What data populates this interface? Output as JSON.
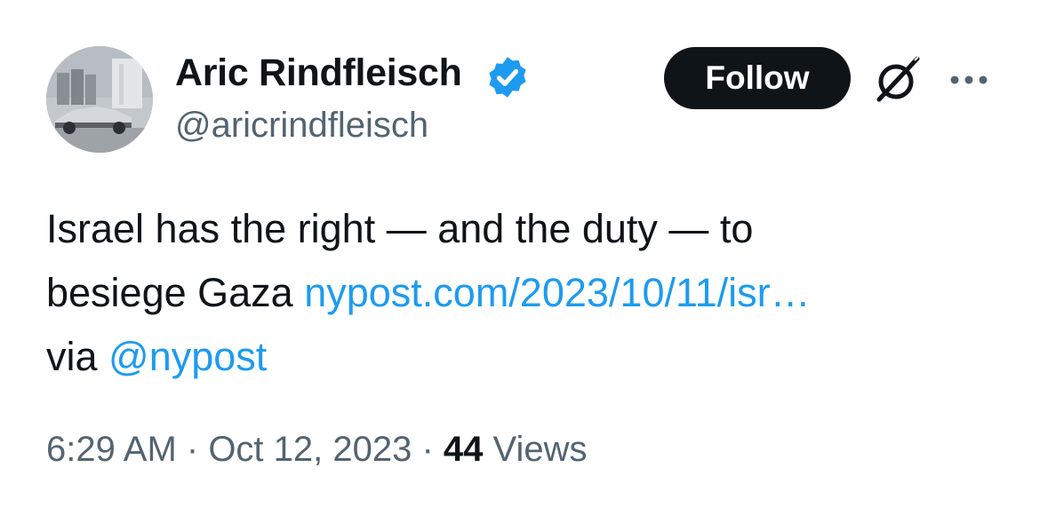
{
  "author": {
    "display_name": "Aric Rindfleisch",
    "handle": "@aricrindfleisch",
    "verified": true
  },
  "actions": {
    "follow_label": "Follow",
    "grok_icon": "grok-icon",
    "more_icon": "more-icon"
  },
  "tweet": {
    "line1": "Israel has the right — and the duty — to",
    "line2_text": "besiege Gaza ",
    "line2_link": "nypost.com/2023/10/11/isr…",
    "line3_text": "via ",
    "line3_mention": "@nypost"
  },
  "meta": {
    "time": "6:29 AM",
    "separator1": " · ",
    "date": "Oct 12, 2023",
    "separator2": " · ",
    "views_count": "44",
    "views_label": " Views"
  },
  "colors": {
    "link": "#1d9bf0",
    "text": "#0f1419",
    "secondary": "#536471",
    "verified": "#1d9bf0",
    "follow_bg": "#0f1419"
  }
}
